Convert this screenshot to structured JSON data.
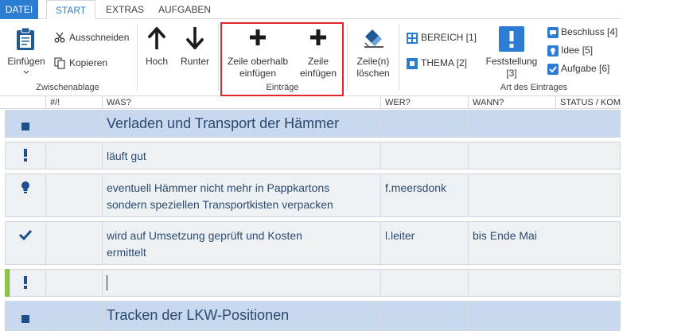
{
  "tabs": {
    "datei": "DATEI",
    "start": "START",
    "extras": "EXTRAS",
    "aufgaben": "AUFGABEN"
  },
  "ribbon": {
    "clipboard": {
      "paste_label": "Einfügen",
      "cut_label": "Ausschneiden",
      "copy_label": "Kopieren",
      "group_label": "Zwischenablage"
    },
    "move": {
      "up_label": "Hoch",
      "down_label": "Runter"
    },
    "entries": {
      "insert_above_line1": "Zeile oberhalb",
      "insert_above_line2": "einfügen",
      "insert_line1": "Zeile",
      "insert_line2": "einfügen",
      "group_label": "Einträge"
    },
    "delete": {
      "line1": "Zeile(n)",
      "line2": "löschen"
    },
    "types": {
      "bereich": "BEREICH [1]",
      "thema": "THEMA [2]",
      "feststellung_line1": "Feststellung",
      "feststellung_line2": "[3]",
      "beschluss": "Beschluss [4]",
      "idee": "Idee [5]",
      "aufgabe": "Aufgabe [6]",
      "group_label": "Art des Eintrages"
    },
    "highlight_color": "#e0262b",
    "accent": "#2b7cd3"
  },
  "grid": {
    "columns": [
      "#/!",
      "WAS?",
      "WER?",
      "WANN?",
      "STATUS / KOM"
    ],
    "rows": [
      {
        "type": "section",
        "icon": "square-icon",
        "was": "Verladen und Transport der Hämmer",
        "wer": "",
        "wann": ""
      },
      {
        "type": "normal",
        "icon": "exclamation-icon",
        "was": "läuft gut",
        "wer": "",
        "wann": ""
      },
      {
        "type": "normal",
        "icon": "lightbulb-icon",
        "was_line1": "eventuell Hämmer nicht mehr in Pappkartons",
        "was_line2": "sondern speziellen Transportkisten verpacken",
        "wer": "f.meersdonk",
        "wann": ""
      },
      {
        "type": "normal",
        "icon": "checkmark-icon",
        "was_line1": "wird auf Umsetzung geprüft und Kosten",
        "was_line2": "ermittelt",
        "wer": "l.leiter",
        "wann": "bis Ende Mai"
      },
      {
        "type": "normal",
        "icon": "exclamation-icon",
        "was": "",
        "wer": "",
        "wann": "",
        "editing": true
      },
      {
        "type": "section",
        "icon": "square-icon",
        "was": "Tracken der LKW-Positionen",
        "wer": "",
        "wann": ""
      }
    ],
    "section_color": "#c7d8ef",
    "row_color": "#eef1f4",
    "active_marker_color": "#8cc63f"
  }
}
